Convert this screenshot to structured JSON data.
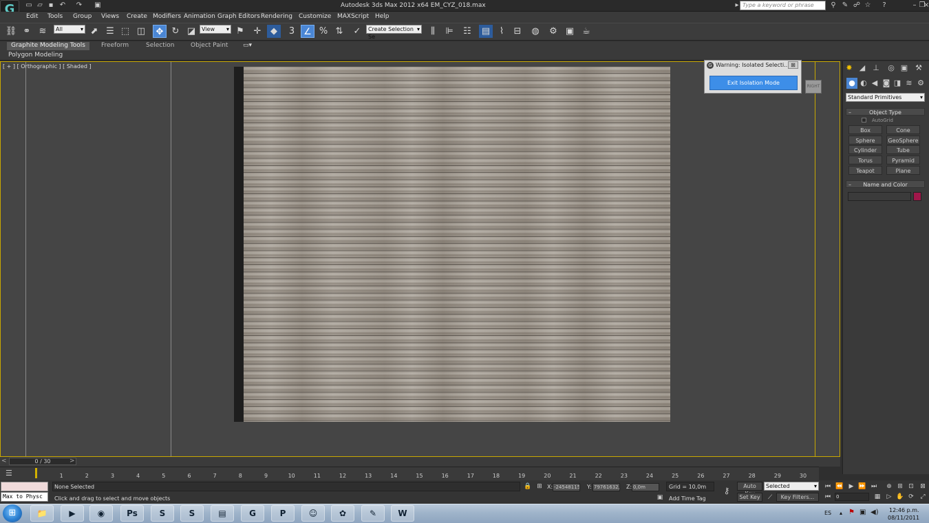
{
  "titlebar": {
    "app_icon": "G",
    "title": "Autodesk 3ds Max  2012 x64     EM_CYZ_018.max",
    "search_placeholder": "Type a keyword or phrase"
  },
  "menu": [
    "Edit",
    "Tools",
    "Group",
    "Views",
    "Create",
    "Modifiers",
    "Animation",
    "Graph Editors",
    "Rendering",
    "Customize",
    "MAXScript",
    "Help"
  ],
  "toolbar": {
    "selection_filter": "All",
    "ref_coord": "View",
    "named_selection": "Create Selection Se",
    "snap_labels": [
      "3",
      "%"
    ]
  },
  "ribbon": {
    "tabs": [
      "Graphite Modeling Tools",
      "Freeform",
      "Selection",
      "Object Paint"
    ],
    "sub": "Polygon Modeling"
  },
  "viewport": {
    "label": "[ + ] [ Orthographic ] [ Shaded ]",
    "viewcube_label": "RIGHT"
  },
  "warning": {
    "title": "Warning: Isolated Selecti...",
    "close": "⊠",
    "button": "Exit Isolation Mode"
  },
  "command_panel": {
    "category": "Standard Primitives",
    "object_type_title": "Object Type",
    "autogrid": "AutoGrid",
    "primitives": [
      "Box",
      "Cone",
      "Sphere",
      "GeoSphere",
      "Cylinder",
      "Tube",
      "Torus",
      "Pyramid",
      "Teapot",
      "Plane"
    ],
    "name_color_title": "Name and Color",
    "object_color": "#a0174a"
  },
  "timeline": {
    "slider": "0 / 30",
    "ticks": [
      "0",
      "1",
      "2",
      "3",
      "4",
      "5",
      "6",
      "7",
      "8",
      "9",
      "10",
      "11",
      "12",
      "13",
      "14",
      "15",
      "16",
      "17",
      "18",
      "19",
      "20",
      "21",
      "22",
      "23",
      "24",
      "25",
      "26",
      "27",
      "28",
      "29",
      "30"
    ]
  },
  "status": {
    "maxscript": "Max to Physc",
    "selection": "None Selected",
    "prompt": "Click and drag to select and move objects",
    "x_label": "X:",
    "x_value": "-24548115",
    "y_label": "Y:",
    "y_value": "79761632,",
    "z_label": "Z:",
    "z_value": "0,0m",
    "grid": "Grid = 10,0m",
    "add_time_tag": "Add Time Tag",
    "auto_key": "Auto Key",
    "set_key": "Set Key",
    "key_mode": "Selected",
    "key_filters": "Key Filters...",
    "current_frame": "0"
  },
  "taskbar": {
    "apps": [
      "explorer-icon",
      "media-player-icon",
      "firefox-icon",
      "photoshop-icon",
      "sketchup-icon",
      "skype-icon",
      "winrar-icon",
      "3dsmax-icon",
      "pixel-icon",
      "messenger-icon",
      "games-icon",
      "notes-icon",
      "word-icon"
    ],
    "app_glyphs": [
      "📁",
      "▶",
      "◉",
      "Ps",
      "S",
      "S",
      "▤",
      "G",
      "P",
      "☺",
      "✿",
      "✎",
      "W"
    ],
    "lang": "ES",
    "time": "12:46 p.m.",
    "date": "08/11/2011"
  }
}
